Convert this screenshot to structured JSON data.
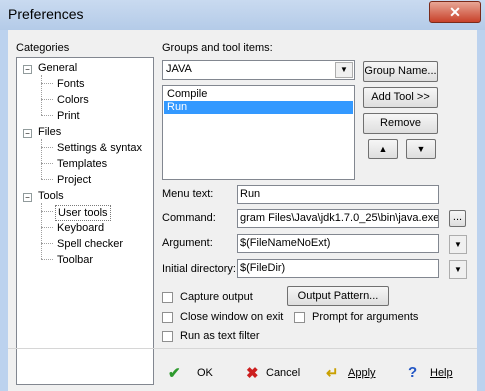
{
  "window": {
    "title": "Preferences",
    "close_glyph": "✕"
  },
  "categories": {
    "label": "Categories",
    "tree": [
      {
        "label": "General",
        "expander": "−",
        "children": [
          "Fonts",
          "Colors",
          "Print"
        ]
      },
      {
        "label": "Files",
        "expander": "−",
        "children": [
          "Settings & syntax",
          "Templates",
          "Project"
        ]
      },
      {
        "label": "Tools",
        "expander": "−",
        "children": [
          "User tools",
          "Keyboard",
          "Spell checker",
          "Toolbar"
        ]
      }
    ],
    "selected": "User tools"
  },
  "groups": {
    "label": "Groups and tool items:",
    "selected_group": "JAVA",
    "items": [
      "Compile",
      "Run"
    ],
    "selected_item": "Run"
  },
  "buttons": {
    "group_name": "Group Name...",
    "add_tool": "Add Tool >>",
    "remove": "Remove",
    "up": "▲",
    "down": "▼",
    "browse": "...",
    "output_pattern": "Output Pattern..."
  },
  "fields": {
    "menu_text_label": "Menu text:",
    "menu_text_value": "Run",
    "command_label": "Command:",
    "command_value": "gram Files\\Java\\jdk1.7.0_25\\bin\\java.exe",
    "argument_label": "Argument:",
    "argument_value": "$(FileNameNoExt)",
    "initial_dir_label": "Initial directory:",
    "initial_dir_value": "$(FileDir)"
  },
  "options": {
    "capture_output": "Capture output",
    "close_window": "Close window on exit",
    "prompt_args": "Prompt for arguments",
    "text_filter": "Run as text filter"
  },
  "footer": {
    "ok": "OK",
    "cancel": "Cancel",
    "apply": "Apply",
    "help": "Help"
  },
  "colors": {
    "selection": "#3399ff",
    "ok_check": "#2e9a2e",
    "cancel_x": "#cc1f1f",
    "apply_arrow": "#c9a000",
    "help_q": "#2256c5"
  }
}
